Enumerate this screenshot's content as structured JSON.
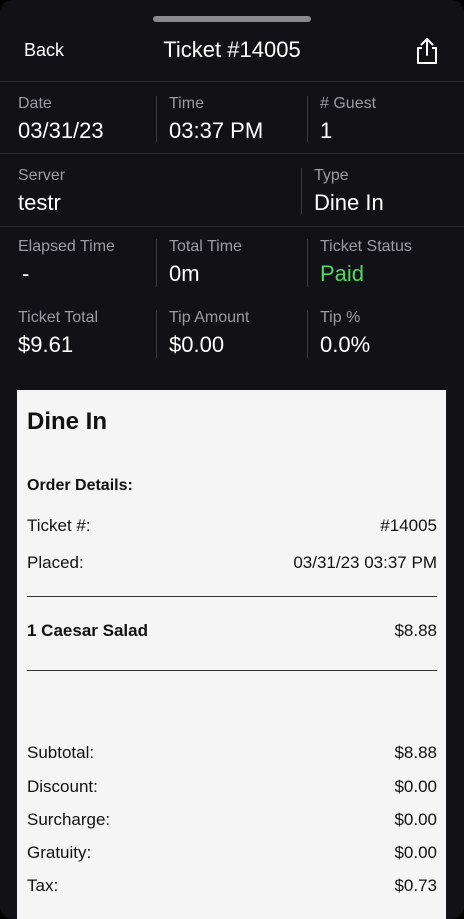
{
  "header": {
    "back_label": "Back",
    "title": "Ticket #14005",
    "share_icon": "share-icon"
  },
  "info": {
    "date_label": "Date",
    "date_value": "03/31/23",
    "time_label": "Time",
    "time_value": "03:37 PM",
    "guest_label": "# Guest",
    "guest_value": "1",
    "server_label": "Server",
    "server_value": "testr",
    "type_label": "Type",
    "type_value": "Dine In",
    "elapsed_label": "Elapsed Time",
    "elapsed_value": "-",
    "total_time_label": "Total Time",
    "total_time_value": "0m",
    "status_label": "Ticket Status",
    "status_value": "Paid",
    "ticket_total_label": "Ticket Total",
    "ticket_total_value": "$9.61",
    "tip_amount_label": "Tip Amount",
    "tip_amount_value": "$0.00",
    "tip_pct_label": "Tip %",
    "tip_pct_value": "0.0%",
    "status_color": "#4cd964"
  },
  "receipt": {
    "title": "Dine In",
    "order_details_label": "Order Details:",
    "ticket_label": "Ticket #:",
    "ticket_value": "#14005",
    "placed_label": "Placed:",
    "placed_value": "03/31/23 03:37 PM",
    "items": [
      {
        "name": "1 Caesar Salad",
        "price": "$8.88"
      }
    ],
    "totals": [
      {
        "label": "Subtotal:",
        "value": "$8.88"
      },
      {
        "label": "Discount:",
        "value": "$0.00"
      },
      {
        "label": "Surcharge:",
        "value": "$0.00"
      },
      {
        "label": "Gratuity:",
        "value": "$0.00"
      },
      {
        "label": "Tax:",
        "value": "$0.73"
      }
    ]
  }
}
